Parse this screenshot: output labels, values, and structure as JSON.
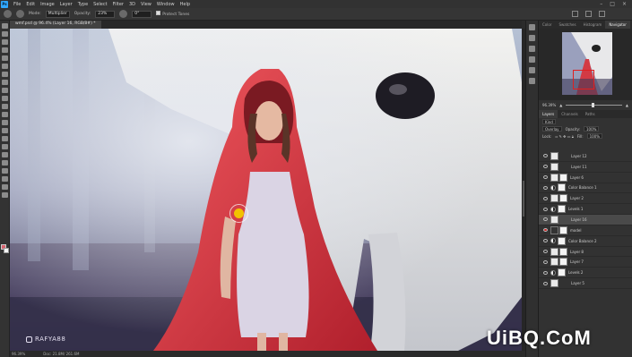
{
  "menubar": {
    "logo": "Ps",
    "items": [
      "File",
      "Edit",
      "Image",
      "Layer",
      "Type",
      "Select",
      "Filter",
      "3D",
      "View",
      "Window",
      "Help"
    ]
  },
  "options": {
    "mode_label": "Mode:",
    "mode_value": "Multiplier",
    "opacity_label": "Opacity:",
    "opacity_value": "23%",
    "flow_value": "0°",
    "protect_tones": "Protect Tones"
  },
  "document": {
    "tab_label": "wmf.psd @ 96.4% (Layer 16, RGB/8#) *"
  },
  "canvas": {
    "credit": "RAFYA88"
  },
  "status": {
    "zoom": "96.39%",
    "doc_info": "Doc: 21.8M/ 261.6M"
  },
  "panels": {
    "top_tabs": [
      "Color",
      "Swatches",
      "Histogram",
      "Navigator"
    ],
    "active_top_tab": 3,
    "zoom_value": "96.39%",
    "layer_tabs": [
      "Layers",
      "Channels",
      "Paths"
    ],
    "kind_label": "Kind",
    "blend_mode": "Overlay",
    "opacity_label": "Opacity:",
    "opacity_value": "100%",
    "lock_label": "Lock:",
    "fill_label": "Fill:",
    "fill_value": "100%"
  },
  "layers": [
    {
      "name": "Layer 12",
      "mask": false,
      "selected": false,
      "adj": false
    },
    {
      "name": "Layer 11",
      "mask": false,
      "selected": false,
      "adj": false
    },
    {
      "name": "Layer 6",
      "mask": true,
      "selected": false,
      "adj": false
    },
    {
      "name": "Color Balance 1",
      "mask": true,
      "selected": false,
      "adj": true
    },
    {
      "name": "Layer 2",
      "mask": true,
      "selected": false,
      "adj": false
    },
    {
      "name": "Levels 1",
      "mask": true,
      "selected": false,
      "adj": true
    },
    {
      "name": "Layer 16",
      "mask": false,
      "selected": true,
      "adj": false
    },
    {
      "name": "model",
      "mask": true,
      "selected": false,
      "adj": false,
      "dark": true
    },
    {
      "name": "Color Balance 2",
      "mask": true,
      "selected": false,
      "adj": true
    },
    {
      "name": "Layer 8",
      "mask": true,
      "selected": false,
      "adj": false
    },
    {
      "name": "Layer 7",
      "mask": true,
      "selected": false,
      "adj": false
    },
    {
      "name": "Levels 2",
      "mask": true,
      "selected": false,
      "adj": true
    },
    {
      "name": "Layer 5",
      "mask": false,
      "selected": false,
      "adj": false
    }
  ],
  "site_watermark": "UiBQ.CoM"
}
